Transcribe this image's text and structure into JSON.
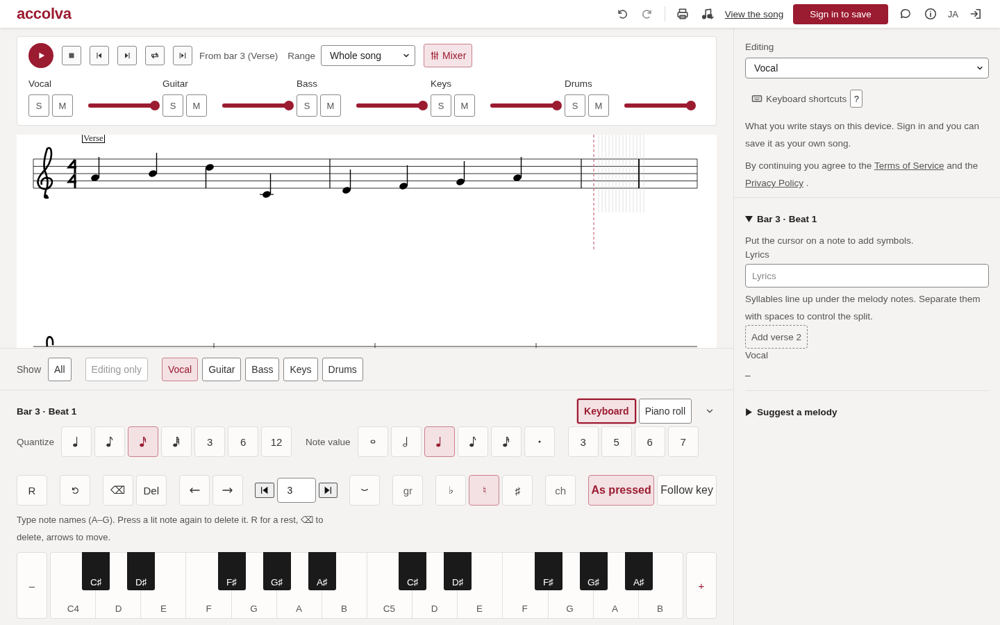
{
  "header": {
    "logo": "accolva",
    "view_link": "View the song",
    "sign_in": "Sign in to save",
    "language": "JA"
  },
  "transport": {
    "position": "From bar 3 (Verse)",
    "range_label": "Range",
    "range_value": "Whole song",
    "mixer": {
      "label": "Mixer",
      "selected": true
    },
    "tracks": [
      {
        "name": "Vocal",
        "solo": "S",
        "mute": "M",
        "level": 1.0
      },
      {
        "name": "Guitar",
        "solo": "S",
        "mute": "M",
        "level": 1.0
      },
      {
        "name": "Bass",
        "solo": "S",
        "mute": "M",
        "level": 1.0
      },
      {
        "name": "Keys",
        "solo": "S",
        "mute": "M",
        "level": 1.0
      },
      {
        "name": "Drums",
        "solo": "S",
        "mute": "M",
        "level": 1.0
      }
    ]
  },
  "score": {
    "section_mark": "Verse"
  },
  "show": {
    "label": "Show",
    "filters": [
      {
        "label": "All",
        "selected": false,
        "disabled": false
      },
      {
        "label": "Editing only",
        "selected": false,
        "disabled": true
      },
      {
        "label": "Vocal",
        "selected": true,
        "disabled": false
      },
      {
        "label": "Guitar",
        "selected": false,
        "disabled": false
      },
      {
        "label": "Bass",
        "selected": false,
        "disabled": false
      },
      {
        "label": "Keys",
        "selected": false,
        "disabled": false
      },
      {
        "label": "Drums",
        "selected": false,
        "disabled": false
      }
    ]
  },
  "editor": {
    "title": "Bar 3 · Beat 1",
    "modes": [
      {
        "label": "Keyboard",
        "selected": true
      },
      {
        "label": "Piano roll",
        "selected": false
      }
    ],
    "quantize": {
      "label": "Quantize",
      "options": [
        {
          "kind": "quarter",
          "selected": false
        },
        {
          "kind": "eighth",
          "selected": false
        },
        {
          "kind": "sixteenth",
          "selected": true
        },
        {
          "kind": "thirtysecond",
          "selected": false
        },
        {
          "kind": "number",
          "label": "3",
          "selected": false
        },
        {
          "kind": "number",
          "label": "6",
          "selected": false
        },
        {
          "kind": "number",
          "label": "12",
          "selected": false
        }
      ]
    },
    "note_value": {
      "label": "Note value",
      "durations": [
        {
          "kind": "whole",
          "selected": false
        },
        {
          "kind": "half",
          "selected": false
        },
        {
          "kind": "quarter",
          "selected": true
        },
        {
          "kind": "eighth",
          "selected": false
        },
        {
          "kind": "sixteenth",
          "selected": false
        },
        {
          "kind": "dot",
          "selected": false
        }
      ],
      "tuplets": [
        {
          "label": "3",
          "selected": false
        },
        {
          "label": "5",
          "selected": false
        },
        {
          "label": "6",
          "selected": false
        },
        {
          "label": "7",
          "selected": false
        }
      ]
    },
    "tools": {
      "rest": "R",
      "backspace": "⌫",
      "delete": "Del",
      "bar_input": "3",
      "grace": "gr",
      "accidentals": [
        {
          "label": "♭",
          "selected": false
        },
        {
          "label": "♮",
          "selected": true
        },
        {
          "label": "♯",
          "selected": false
        }
      ],
      "chord": "ch",
      "spelling": [
        {
          "label": "As pressed",
          "selected": true
        },
        {
          "label": "Follow key",
          "selected": false
        }
      ]
    },
    "hint": "Type note names (A–G). Press a lit note again to delete it. R for a rest, ⌫ to delete, arrows to move.",
    "piano": {
      "octave_down": "–",
      "octave_up": "+",
      "white_keys": [
        "C4",
        "D",
        "E",
        "F",
        "G",
        "A",
        "B",
        "C5",
        "D",
        "E",
        "F",
        "G",
        "A",
        "B"
      ],
      "black_keys": [
        "C♯",
        "D♯",
        "F♯",
        "G♯",
        "A♯",
        "C♯",
        "D♯",
        "F♯",
        "G♯",
        "A♯"
      ]
    }
  },
  "sidebar": {
    "editing_label": "Editing",
    "editing_value": "Vocal",
    "shortcuts": "Keyboard shortcuts",
    "help_button": "?",
    "note": "What you write stays on this device. Sign in and you can save it as your own song.",
    "consent": {
      "before": "By continuing you agree to the",
      "terms": "Terms of Service",
      "middle": "and the",
      "privacy": "Privacy Policy",
      "after": "."
    },
    "sections": [
      {
        "title": "Bar 3 · Beat 1",
        "expanded": true,
        "hint": "Put the cursor on a note to add symbols.",
        "lyrics_label": "Lyrics",
        "lyrics_placeholder": "Lyrics",
        "lyrics_help": "Syllables line up under the melody notes. Separate them with spaces to control the split.",
        "add_verse": "Add verse 2",
        "track_label": "Vocal",
        "track_value": "–"
      },
      {
        "title": "Suggest a melody",
        "expanded": false
      }
    ]
  }
}
